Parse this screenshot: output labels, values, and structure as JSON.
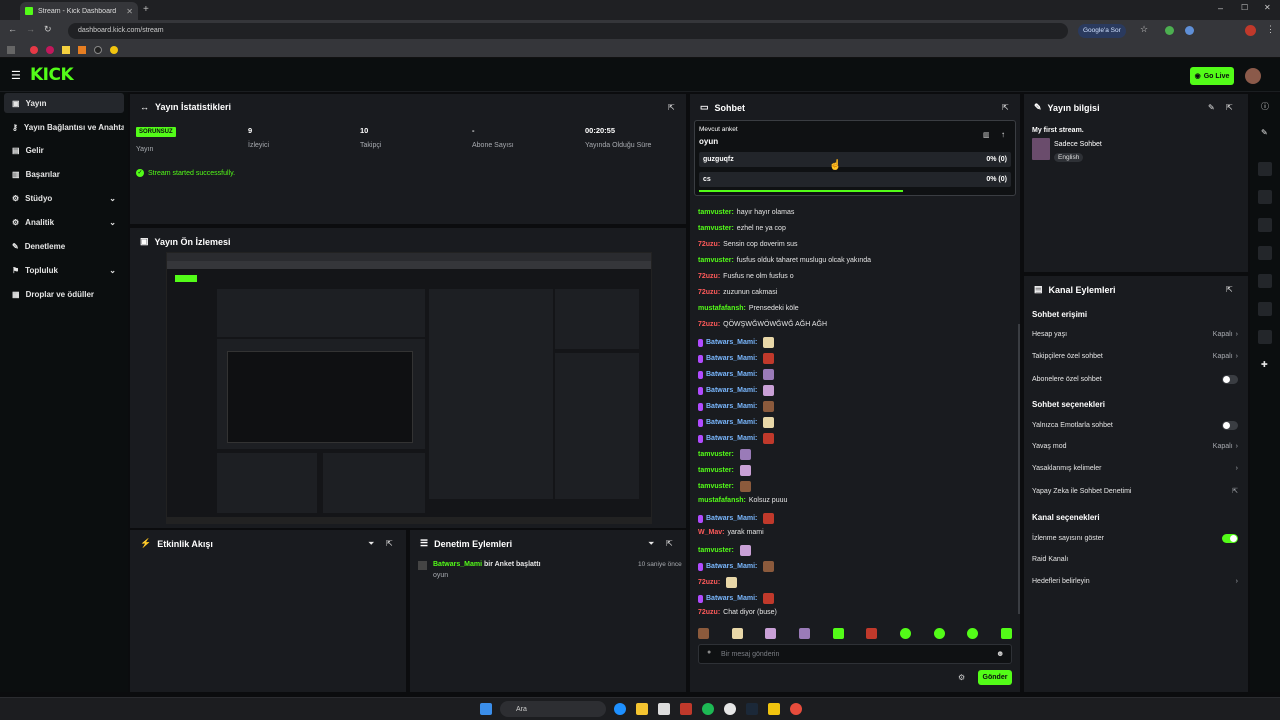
{
  "browser": {
    "tab_title": "Stream - Kick Dashboard",
    "url": "dashboard.kick.com/stream",
    "google_button": "Google'a Sor"
  },
  "header": {
    "logo": "KICK",
    "go_live": "Go Live"
  },
  "sidebar": {
    "items": [
      {
        "label": "Yayın"
      },
      {
        "label": "Yayın Bağlantısı ve Anahtarı"
      },
      {
        "label": "Gelir"
      },
      {
        "label": "Başarılar"
      },
      {
        "label": "Stüdyo"
      },
      {
        "label": "Analitik"
      },
      {
        "label": "Denetleme"
      },
      {
        "label": "Topluluk"
      },
      {
        "label": "Droplar ve ödüller"
      }
    ]
  },
  "stats": {
    "title": "Yayın İstatistikleri",
    "badge": "SORUNSUZ",
    "badge_label": "Yayın",
    "items": [
      {
        "value": "9",
        "label": "İzleyici"
      },
      {
        "value": "10",
        "label": "Takipçi"
      },
      {
        "value": "-",
        "label": "Abone Sayısı"
      },
      {
        "value": "00:20:55",
        "label": "Yayında Olduğu Süre"
      }
    ],
    "success": "Stream started successfully."
  },
  "preview": {
    "title": "Yayın Ön İzlemesi"
  },
  "activity": {
    "title": "Etkinlik Akışı"
  },
  "mod": {
    "title": "Denetim Eylemleri",
    "entry_user": "Batwars_Mami",
    "entry_text": "bir Anket başlattı",
    "entry_sub": "oyun",
    "entry_time": "10 saniye önce"
  },
  "chat": {
    "title": "Sohbet",
    "poll": {
      "label": "Mevcut anket",
      "question": "oyun",
      "options": [
        {
          "name": "guzguqfz",
          "result": "0% (0)"
        },
        {
          "name": "cs",
          "result": "0% (0)"
        }
      ]
    },
    "messages": [
      {
        "user": "tamvuster:",
        "color": "green",
        "text": "hayır hayır olamas"
      },
      {
        "user": "tamvuster:",
        "color": "green",
        "text": "ezhel ne ya cop"
      },
      {
        "user": "72uzu:",
        "color": "red",
        "text": "Sensin cop doverim sus"
      },
      {
        "user": "tamvuster:",
        "color": "green",
        "text": "fusfus olduk taharet muslugu olcak yakında"
      },
      {
        "user": "72uzu:",
        "color": "red",
        "text": "Fusfus ne olm fusfus o"
      },
      {
        "user": "72uzu:",
        "color": "red",
        "text": "zuzunun cakmasi"
      },
      {
        "user": "mustafafansh:",
        "color": "green",
        "text": "Prensedeki köle"
      },
      {
        "user": "72uzu:",
        "color": "red",
        "text": "QÖWŞWĞWÖWĞWĞ AĞH AĞH"
      },
      {
        "user": "Batwars_Mami:",
        "color": "purple",
        "text": ""
      },
      {
        "user": "Batwars_Mami:",
        "color": "purple",
        "text": ""
      },
      {
        "user": "Batwars_Mami:",
        "color": "purple",
        "text": ""
      },
      {
        "user": "Batwars_Mami:",
        "color": "purple",
        "text": ""
      },
      {
        "user": "Batwars_Mami:",
        "color": "purple",
        "text": ""
      },
      {
        "user": "Batwars_Mami:",
        "color": "purple",
        "text": ""
      },
      {
        "user": "Batwars_Mami:",
        "color": "purple",
        "text": ""
      },
      {
        "user": "tamvuster:",
        "color": "green",
        "text": ""
      },
      {
        "user": "tamvuster:",
        "color": "green",
        "text": ""
      },
      {
        "user": "tamvuster:",
        "color": "green",
        "text": ""
      },
      {
        "user": "mustafafansh:",
        "color": "green",
        "text": "Kolsuz puuu"
      },
      {
        "user": "Batwars_Mami:",
        "color": "purple",
        "text": ""
      },
      {
        "user": "W_Mav:",
        "color": "red",
        "text": "yarak mami"
      },
      {
        "user": "tamvuster:",
        "color": "green",
        "text": ""
      },
      {
        "user": "Batwars_Mami:",
        "color": "purple",
        "text": ""
      },
      {
        "user": "72uzu:",
        "color": "red",
        "text": ""
      },
      {
        "user": "Batwars_Mami:",
        "color": "purple",
        "text": ""
      },
      {
        "user": "72uzu:",
        "color": "red",
        "text": "Chat diyor (buse)"
      }
    ],
    "input_placeholder": "Bir mesaj gönderin",
    "send": "Gönder"
  },
  "streaminfo": {
    "title": "Yayın bilgisi",
    "stream_title": "My first stream.",
    "category": "Sadece Sohbet",
    "language": "English"
  },
  "channel": {
    "title": "Kanal Eylemleri",
    "sections": {
      "access": "Sohbet erişimi",
      "options": "Sohbet seçenekleri",
      "channel": "Kanal seçenekleri"
    },
    "rows": {
      "account_age": "Hesap yaşı",
      "account_age_val": "Kapalı",
      "followers_only": "Takipçilere özel sohbet",
      "followers_only_val": "Kapalı",
      "subs_only": "Abonelere özel sohbet",
      "emotes_only": "Yalnızca Emotlarla sohbet",
      "slow_mode": "Yavaş mod",
      "slow_mode_val": "Kapalı",
      "banned_words": "Yasaklanmış kelimeler",
      "ai_mod": "Yapay Zeka ile Sohbet Denetimi",
      "show_viewers": "İzlenme sayısını göster",
      "raid": "Raid Kanalı",
      "targets": "Hedefleri belirleyin"
    },
    "toggles": {
      "subs_only": false,
      "emotes_only": false,
      "show_viewers": true
    }
  },
  "taskbar": {
    "search": "Ara"
  },
  "colors": {
    "accent": "#53fc18",
    "panel": "#191b1f",
    "background": "#0b0c0e"
  }
}
